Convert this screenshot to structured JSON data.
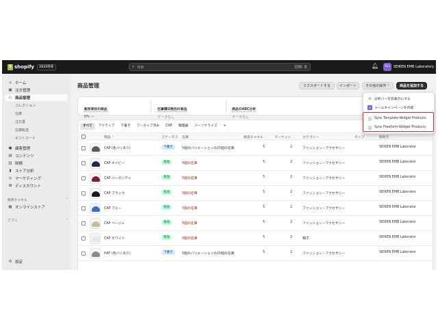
{
  "topbar": {
    "brand": "shopify",
    "edition": "2025年冬",
    "search_placeholder": "検索",
    "shortcut": [
      "CTRL",
      "K"
    ],
    "avatar_initials": "SEL",
    "store_name": "SEIKEN EMB Laboratory"
  },
  "sidebar": {
    "items": [
      {
        "label": "ホーム",
        "icon": "home-icon"
      },
      {
        "label": "注文管理",
        "icon": "inbox-icon"
      },
      {
        "label": "商品管理",
        "icon": "tag-icon"
      },
      {
        "label": "コレクション"
      },
      {
        "label": "在庫"
      },
      {
        "label": "注文書"
      },
      {
        "label": "在庫転送"
      },
      {
        "label": "ギフトカード"
      },
      {
        "label": "顧客管理",
        "icon": "person-icon"
      },
      {
        "label": "コンテンツ",
        "icon": "content-icon"
      },
      {
        "label": "財務",
        "icon": "bank-icon"
      },
      {
        "label": "ストア分析",
        "icon": "chart-icon"
      },
      {
        "label": "マーケティング",
        "icon": "target-icon"
      },
      {
        "label": "ディスカウント",
        "icon": "discount-icon"
      }
    ],
    "sales_channels_label": "販売チャネル",
    "online_store": "オンラインストア",
    "apps_label": "アプリ",
    "settings": "設定"
  },
  "main": {
    "title": "商品管理",
    "buttons": {
      "export": "エクスポートする",
      "import": "インポート",
      "more_actions": "その他の操作",
      "add_product": "商品を追加する"
    },
    "metrics": [
      {
        "label": "販売率別の商品",
        "value": "0%  —"
      },
      {
        "label": "在庫積日数別の商品",
        "value": "データなし"
      },
      {
        "label": "商品のABC分析",
        "value": "データなし"
      }
    ],
    "tabs": [
      "すべて",
      "アクティブ",
      "下書き",
      "アーカイブ済み",
      "CAP",
      "帽面器",
      "パーソナライズ",
      "+"
    ],
    "columns": [
      "商品",
      "ステータス",
      "在庫",
      "販売チャネル",
      "マーケット",
      "カテゴリー",
      "タイプ",
      "販売元"
    ],
    "sort_icon": "⌃",
    "rows": [
      {
        "name": "CAP (色バリあり)",
        "status": "下書き",
        "status_type": "draft",
        "inventory": "5個のバリエーションの25個の在庫",
        "inv_red": false,
        "channels": "5",
        "markets": "2",
        "category": "ファッション・アクセサリー",
        "vendor": "SEIKEN EMB Laborator",
        "cap_color": "#5a5a5a"
      },
      {
        "name": "CAP ネイビー",
        "status": "有効",
        "status_type": "active",
        "inventory": "5個の在庫",
        "inv_red": true,
        "channels": "5",
        "markets": "2",
        "category": "ファッション・アクセサリー",
        "vendor": "SEIKEN EMB Laborator",
        "cap_color": "#1f2a4a"
      },
      {
        "name": "CAP バーガンディ",
        "status": "有効",
        "status_type": "active",
        "inventory": "5個の在庫",
        "inv_red": true,
        "channels": "5",
        "markets": "2",
        "category": "ファッション・アクセサリー",
        "vendor": "SEIKEN EMB Laborator",
        "cap_color": "#7a1f2b"
      },
      {
        "name": "CAP ブラック",
        "status": "有効",
        "status_type": "active",
        "inventory": "5個の在庫",
        "inv_red": true,
        "channels": "5",
        "markets": "2",
        "category": "ファッション・アクセサリー",
        "vendor": "SEIKEN EMB Laborator",
        "cap_color": "#1a1a1a"
      },
      {
        "name": "CAP ブルー",
        "status": "有効",
        "status_type": "active",
        "inventory": "5個の在庫",
        "inv_red": true,
        "channels": "5",
        "markets": "2",
        "category": "ファッション・アクセサリー",
        "vendor": "SEIKEN EMB Laborator",
        "cap_color": "#3d6fb8"
      },
      {
        "name": "CAP ベージュ",
        "status": "有効",
        "status_type": "active",
        "inventory": "5個の在庫",
        "inv_red": true,
        "channels": "5",
        "markets": "2",
        "category": "ファッション・アクセサリー",
        "vendor": "SEIKEN EMB Laborator",
        "cap_color": "#cdbb98"
      },
      {
        "name": "CAP ホワイト",
        "status": "有効",
        "status_type": "active",
        "inventory": "0個の在庫",
        "inv_red": true,
        "channels": "5",
        "markets": "2",
        "category": "帽子",
        "vendor": "SEIKEN EMB Laborator",
        "cap_color": "#e8e8e8"
      },
      {
        "name": "HAT (色バリあり)",
        "status": "下書き",
        "status_type": "draft",
        "inventory": "5個のバリエーションの25個の在庫",
        "inv_red": false,
        "channels": "5",
        "markets": "2",
        "category": "ファッション・アクセサリー",
        "vendor": "SEIKEN EMB Laborator",
        "cap_color": "#8a8a8a"
      }
    ]
  },
  "dropdown": {
    "items": [
      {
        "label": "分析バーを非表示にする",
        "icon": "eye-off-icon"
      },
      {
        "label": "メールキャンペーンを作成",
        "icon": "mail-icon"
      },
      {
        "label": "Sync Template-Widget Products",
        "icon": "document-icon"
      },
      {
        "label": "Sync Freeform-Widget Products",
        "icon": "document-icon"
      }
    ]
  },
  "colors": {
    "highlight": "#d72c2c",
    "active_badge": "#b4fed2",
    "draft_badge": "#d5ebff",
    "topbar": "#1a1a1a"
  }
}
